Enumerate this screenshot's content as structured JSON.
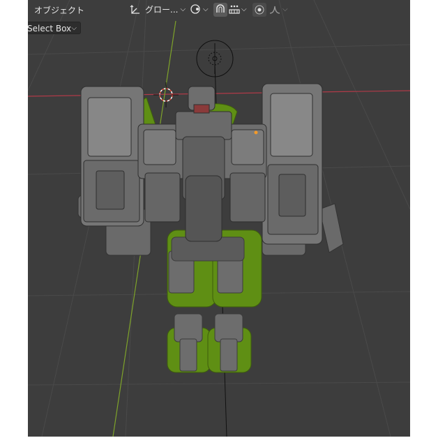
{
  "header": {
    "mode_label": "オブジェクト",
    "transform_orientation": "グロー...",
    "transform_orientation_icon": "transform-orientation-icon",
    "pivot_icon": "pivot-icon",
    "snap_icon": "magnet-icon",
    "snap_increment_icon": "snap-increment-icon",
    "proportional_edit_icon": "proportional-edit-icon",
    "falloff_icon": "falloff-curve-icon",
    "dropdown_icon": "chevron-down-icon"
  },
  "tool": {
    "select_mode": "Select Box"
  },
  "viewport": {
    "background": "#3d3d3d",
    "grid_color": "#4a4a4a",
    "x_axis_color": "#b03a48",
    "y_axis_color": "#7ea32a",
    "model_body_color": "#707070",
    "model_accent_color": "#6b9e14"
  }
}
